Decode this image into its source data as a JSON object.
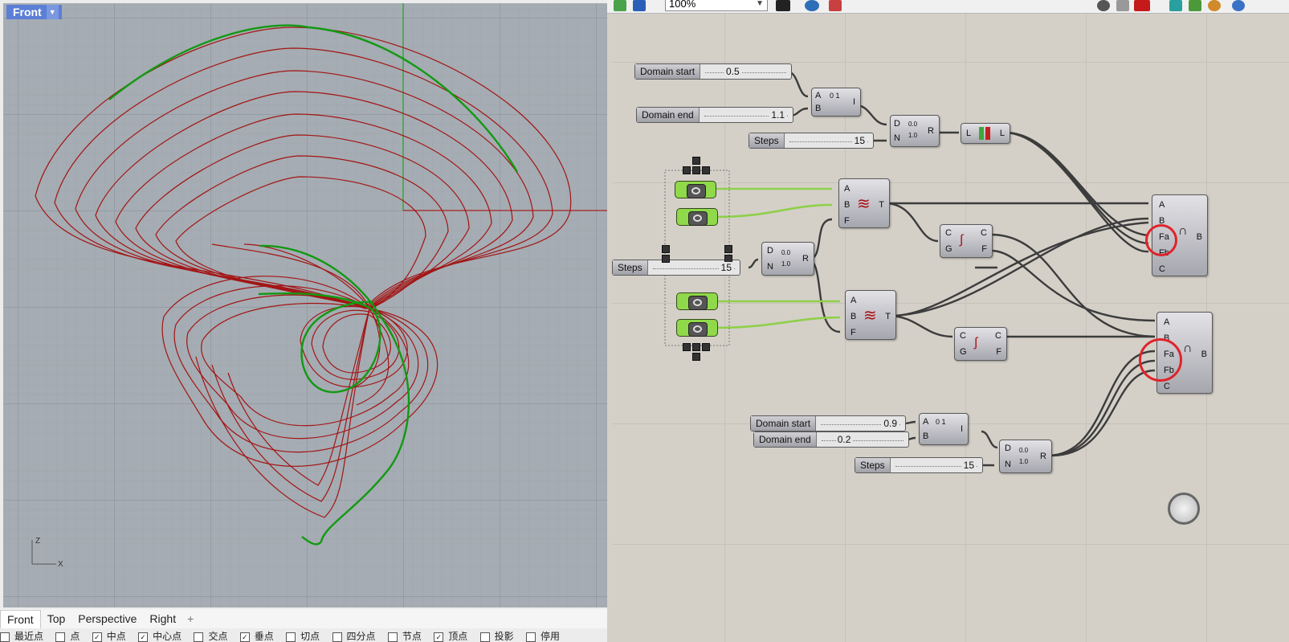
{
  "viewport": {
    "active_view": "Front",
    "tabs": [
      "Front",
      "Top",
      "Perspective",
      "Right"
    ],
    "add_tab": "+",
    "axis_z": "Z",
    "axis_x": "X"
  },
  "osnap": {
    "items": [
      {
        "label": "最近点",
        "checked": false
      },
      {
        "label": "点",
        "checked": false
      },
      {
        "label": "中点",
        "checked": true
      },
      {
        "label": "中心点",
        "checked": true
      },
      {
        "label": "交点",
        "checked": false
      },
      {
        "label": "垂点",
        "checked": true
      },
      {
        "label": "切点",
        "checked": false
      },
      {
        "label": "四分点",
        "checked": false
      },
      {
        "label": "节点",
        "checked": false
      },
      {
        "label": "顶点",
        "checked": true
      },
      {
        "label": "投影",
        "checked": false
      },
      {
        "label": "停用",
        "checked": false
      }
    ]
  },
  "grasshopper": {
    "zoom": "100%",
    "sliders": {
      "domain_start_1": {
        "name": "Domain start",
        "value": "0.5"
      },
      "domain_end_1": {
        "name": "Domain end",
        "value": "1.1"
      },
      "steps_1": {
        "name": "Steps",
        "value": "15"
      },
      "steps_2": {
        "name": "Steps",
        "value": "15"
      },
      "domain_start_2": {
        "name": "Domain start",
        "value": "0.9"
      },
      "domain_end_2": {
        "name": "Domain end",
        "value": "0.2"
      },
      "steps_3": {
        "name": "Steps",
        "value": "15"
      }
    },
    "ports": {
      "A": "A",
      "B": "B",
      "I": "I",
      "D": "D",
      "N": "N",
      "R": "R",
      "L": "L",
      "F": "F",
      "T": "T",
      "C": "C",
      "G": "G",
      "Fa": "Fa",
      "Fb": "Fb"
    },
    "range_icon": {
      "top": "0.0",
      "bottom": "1.0"
    },
    "domain_icon": "0  1"
  }
}
